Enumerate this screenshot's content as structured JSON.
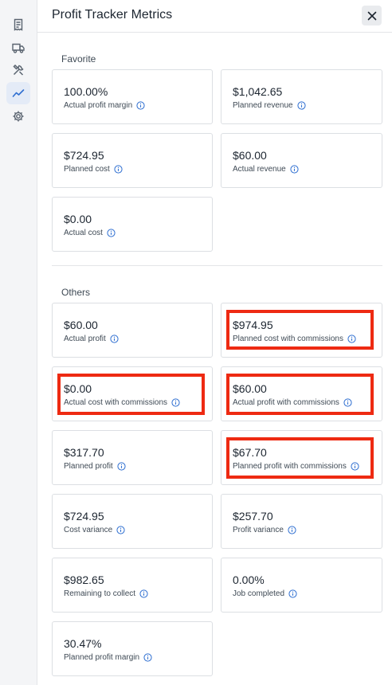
{
  "header": {
    "title": "Profit Tracker Metrics"
  },
  "rail": {
    "items": [
      {
        "icon": "receipt-icon"
      },
      {
        "icon": "truck-icon"
      },
      {
        "icon": "tools-icon"
      },
      {
        "icon": "trend-chart-icon",
        "active": true
      },
      {
        "icon": "gear-icon"
      }
    ]
  },
  "favorite": {
    "label": "Favorite",
    "cards": [
      {
        "value": "100.00%",
        "label": "Actual profit margin"
      },
      {
        "value": "$1,042.65",
        "label": "Planned revenue"
      },
      {
        "value": "$724.95",
        "label": "Planned cost"
      },
      {
        "value": "$60.00",
        "label": "Actual revenue"
      },
      {
        "value": "$0.00",
        "label": "Actual cost"
      }
    ]
  },
  "others": {
    "label": "Others",
    "cards": [
      {
        "value": "$60.00",
        "label": "Actual profit"
      },
      {
        "value": "$974.95",
        "label": "Planned cost with commissions",
        "highlighted": true
      },
      {
        "value": "$0.00",
        "label": "Actual cost with commissions",
        "highlighted": true
      },
      {
        "value": "$60.00",
        "label": "Actual profit with commissions",
        "highlighted": true
      },
      {
        "value": "$317.70",
        "label": "Planned profit"
      },
      {
        "value": "$67.70",
        "label": "Planned profit with commissions",
        "highlighted": true
      },
      {
        "value": "$724.95",
        "label": "Cost variance"
      },
      {
        "value": "$257.70",
        "label": "Profit variance"
      },
      {
        "value": "$982.65",
        "label": "Remaining to collect"
      },
      {
        "value": "0.00%",
        "label": "Job completed"
      },
      {
        "value": "30.47%",
        "label": "Planned profit margin"
      }
    ]
  },
  "colors": {
    "highlight": "#ee2a12",
    "accent": "#2f6fd1",
    "info_icon": "#2f6fd1"
  }
}
